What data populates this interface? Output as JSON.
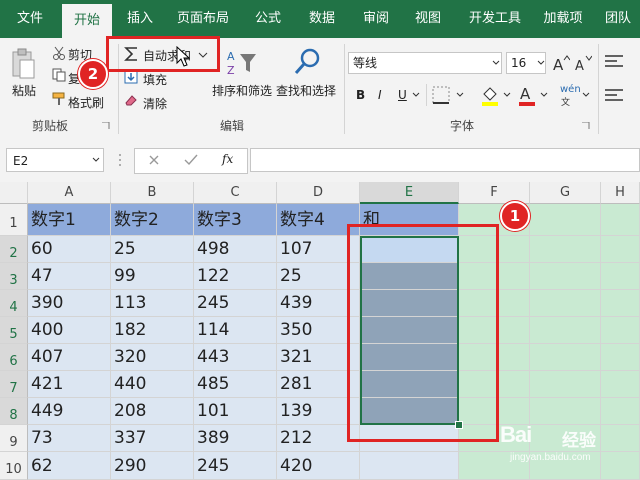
{
  "tabs": [
    "文件",
    "开始",
    "插入",
    "页面布局",
    "公式",
    "数据",
    "审阅",
    "视图",
    "开发工具",
    "加载项",
    "团队"
  ],
  "ribbon": {
    "clipboard": {
      "paste": "粘贴",
      "cut": "剪切",
      "copy": "复",
      "format_painter": "格式刷",
      "group_label": "剪贴板"
    },
    "edit": {
      "autosum": "自动求和",
      "fill": "填充",
      "clear": "清除",
      "sort_filter": "排序和筛选",
      "find_select": "查找和选择",
      "group_label": "编辑"
    },
    "font": {
      "font_name": "等线",
      "font_size": "16",
      "bold": "B",
      "italic": "I",
      "underline": "U",
      "phonetic": "wén",
      "group_label": "字体"
    }
  },
  "formula_bar": {
    "name_box": "E2",
    "fx": "fx",
    "formula": ""
  },
  "columns": [
    "A",
    "B",
    "C",
    "D",
    "E",
    "F",
    "G",
    "H"
  ],
  "rows": [
    "1",
    "2",
    "3",
    "4",
    "5",
    "6",
    "7",
    "8",
    "9",
    "10"
  ],
  "sheet": {
    "header": [
      "数字1",
      "数字2",
      "数字3",
      "数字4",
      "和"
    ],
    "data": [
      [
        "60",
        "25",
        "498",
        "107",
        ""
      ],
      [
        "47",
        "99",
        "122",
        "25",
        ""
      ],
      [
        "390",
        "113",
        "245",
        "439",
        ""
      ],
      [
        "400",
        "182",
        "114",
        "350",
        ""
      ],
      [
        "407",
        "320",
        "443",
        "321",
        ""
      ],
      [
        "421",
        "440",
        "485",
        "281",
        ""
      ],
      [
        "449",
        "208",
        "101",
        "139",
        ""
      ],
      [
        "73",
        "337",
        "389",
        "212",
        ""
      ],
      [
        "62",
        "290",
        "245",
        "420",
        ""
      ]
    ]
  },
  "annotations": {
    "badge1": "1",
    "badge2": "2"
  },
  "watermark": {
    "brand": "Bai",
    "brand2": "经验",
    "url": "jingyan.baidu.com"
  },
  "colors": {
    "accent": "#217346",
    "annotation": "#e02424",
    "header_fill": "#8eaadb",
    "band_fill": "#dce6f2",
    "selected_fill": "#8fa3b8",
    "green_fill": "#c9ead2"
  }
}
